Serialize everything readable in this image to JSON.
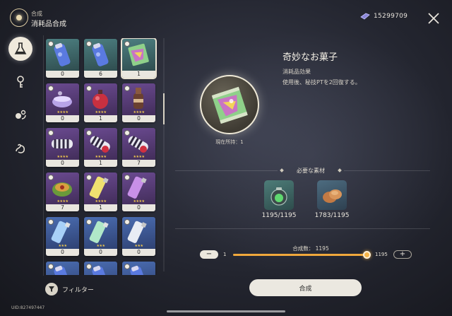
{
  "header": {
    "breadcrumb": "合成",
    "title": "消耗品合成",
    "currency_icon": "crystal-icon",
    "currency_value": "15299709",
    "close_icon": "close-icon"
  },
  "nav": [
    {
      "icon": "flask-icon",
      "active": true
    },
    {
      "icon": "key-icon",
      "active": false
    },
    {
      "icon": "swirl-orbs-icon",
      "active": false
    },
    {
      "icon": "dragon-scroll-icon",
      "active": false
    }
  ],
  "items": [
    {
      "count": "0",
      "icon": "blue-bottle-icon",
      "stars": "",
      "theme": "teal",
      "tag": true
    },
    {
      "count": "6",
      "icon": "blue-bottle-icon",
      "stars": "",
      "theme": "teal",
      "tag": true
    },
    {
      "count": "1",
      "icon": "snack-bag-icon",
      "stars": "",
      "theme": "teal",
      "tag": true,
      "selected": true
    },
    {
      "count": "0",
      "icon": "purple-bowl-icon",
      "stars": "★★★★",
      "theme": "purple",
      "tag": true
    },
    {
      "count": "1",
      "icon": "red-orb-icon",
      "stars": "★★★★",
      "theme": "purple",
      "tag": true
    },
    {
      "count": "0",
      "icon": "brown-bottle-icon",
      "stars": "★★★★",
      "theme": "purple",
      "tag": true
    },
    {
      "count": "0",
      "icon": "zebra-roll-icon",
      "stars": "★★★★",
      "theme": "purple",
      "tag": true
    },
    {
      "count": "1",
      "icon": "zebra-roll-red-icon",
      "stars": "★★★★",
      "theme": "purple",
      "tag": true
    },
    {
      "count": "7",
      "icon": "zebra-roll-red-icon",
      "stars": "★★★★",
      "theme": "purple",
      "tag": true
    },
    {
      "count": "7",
      "icon": "green-cake-icon",
      "stars": "★★★★",
      "theme": "purple",
      "tag": true
    },
    {
      "count": "1",
      "icon": "yellow-tube-icon",
      "stars": "★★★★",
      "theme": "purple",
      "tag": true
    },
    {
      "count": "0",
      "icon": "purple-tube-icon",
      "stars": "★★★★",
      "theme": "purple",
      "tag": true
    },
    {
      "count": "0",
      "icon": "blue-tube-icon",
      "stars": "★★★",
      "theme": "blue",
      "tag": true
    },
    {
      "count": "0",
      "icon": "green-tube-icon",
      "stars": "★★★",
      "theme": "blue",
      "tag": true
    },
    {
      "count": "0",
      "icon": "white-tube-icon",
      "stars": "★★★",
      "theme": "blue",
      "tag": true
    },
    {
      "count": "",
      "icon": "blue-bottle-icon",
      "stars": "",
      "theme": "blue",
      "tag": true
    },
    {
      "count": "",
      "icon": "blue-bottle-icon",
      "stars": "",
      "theme": "blue",
      "tag": true
    },
    {
      "count": "",
      "icon": "blue-bottle-icon",
      "stars": "",
      "theme": "blue",
      "tag": true
    }
  ],
  "filter_label": "フィルター",
  "uid": "UID:827497447",
  "detail": {
    "name": "奇妙なお菓子",
    "category": "消耗品効果",
    "description": "使用後、秘技PTを2回復する。",
    "owned": "現在所持：1",
    "materials_title": "必要な素材",
    "materials": [
      {
        "icon": "green-jar-icon",
        "count": "1195/1195"
      },
      {
        "icon": "bread-icon",
        "count": "1783/1195"
      }
    ]
  },
  "craft": {
    "qty_label": "合成数： 1195",
    "min": "1",
    "max": "1195",
    "level": 1.0,
    "minus_label": "−",
    "plus_label": "+",
    "button_label": "合成"
  },
  "colors": {
    "teal": "#3f6f72",
    "purple": "#5a3d7a",
    "blue": "#3a5590",
    "accent": "#f0a83c"
  }
}
